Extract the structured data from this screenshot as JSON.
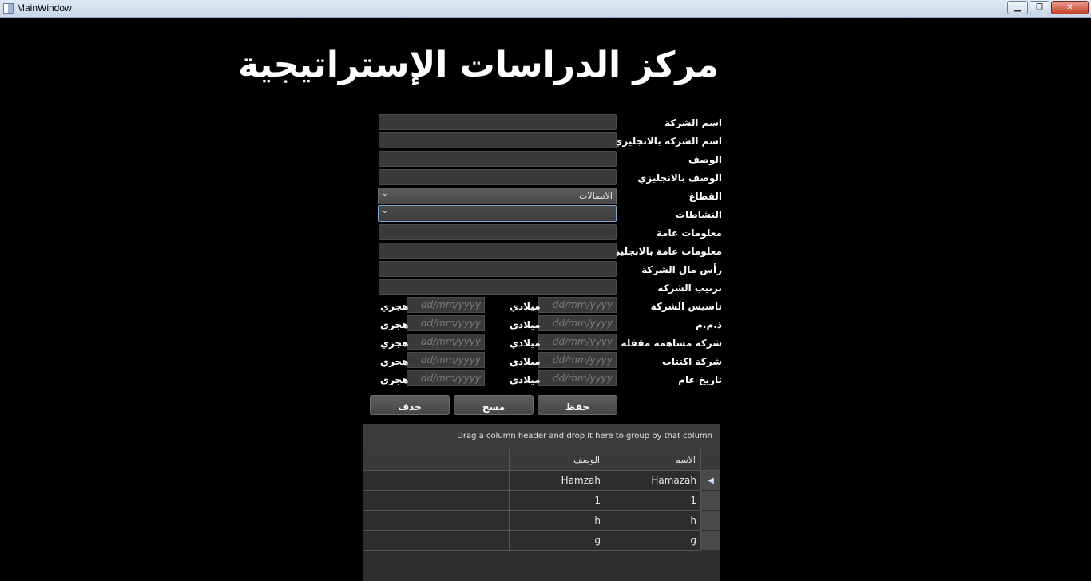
{
  "window": {
    "title": "MainWindow",
    "minimize": "▁",
    "maximize": "❐",
    "close": "✕"
  },
  "heading": "مركز الدراسات الإستراتيجية",
  "form": {
    "fields": [
      {
        "label": "اسم الشركة",
        "value": ""
      },
      {
        "label": "اسم الشركة بالانجليزي",
        "value": ""
      },
      {
        "label": "الوصف",
        "value": ""
      },
      {
        "label": "الوصف بالانجليزي",
        "value": ""
      },
      {
        "label": "القطاغ",
        "value": "الاتصالات"
      },
      {
        "label": "النشاطات",
        "value": ""
      },
      {
        "label": "معلومات عامة",
        "value": ""
      },
      {
        "label": "معلومات عامة بالانجليزية",
        "value": ""
      },
      {
        "label": "رأس مال الشركة",
        "value": ""
      },
      {
        "label": "ترتيب الشركة",
        "value": ""
      }
    ],
    "date_rows": [
      {
        "label": "تاسيس الشركة"
      },
      {
        "label": "ذ.م.م"
      },
      {
        "label": "شركة مساهمة مقفلة"
      },
      {
        "label": "شركة اكتتاب"
      },
      {
        "label": "تاريخ عام"
      }
    ],
    "gregorian_label": "ميلادي",
    "hijri_label": "هجري",
    "date_placeholder": "dd/mm/yyyy"
  },
  "buttons": {
    "save": "حفظ",
    "clear": "مسح",
    "delete": "حذف"
  },
  "grid": {
    "group_panel_text": "Drag a column header and drop it here to group by that column",
    "columns": [
      "الاسم",
      "الوصف"
    ],
    "rows": [
      {
        "name": "Hamazah",
        "desc": "Hamzah"
      },
      {
        "name": "1",
        "desc": "1"
      },
      {
        "name": "h",
        "desc": "h"
      },
      {
        "name": "g",
        "desc": "g"
      }
    ],
    "current_row_marker": "◀"
  }
}
